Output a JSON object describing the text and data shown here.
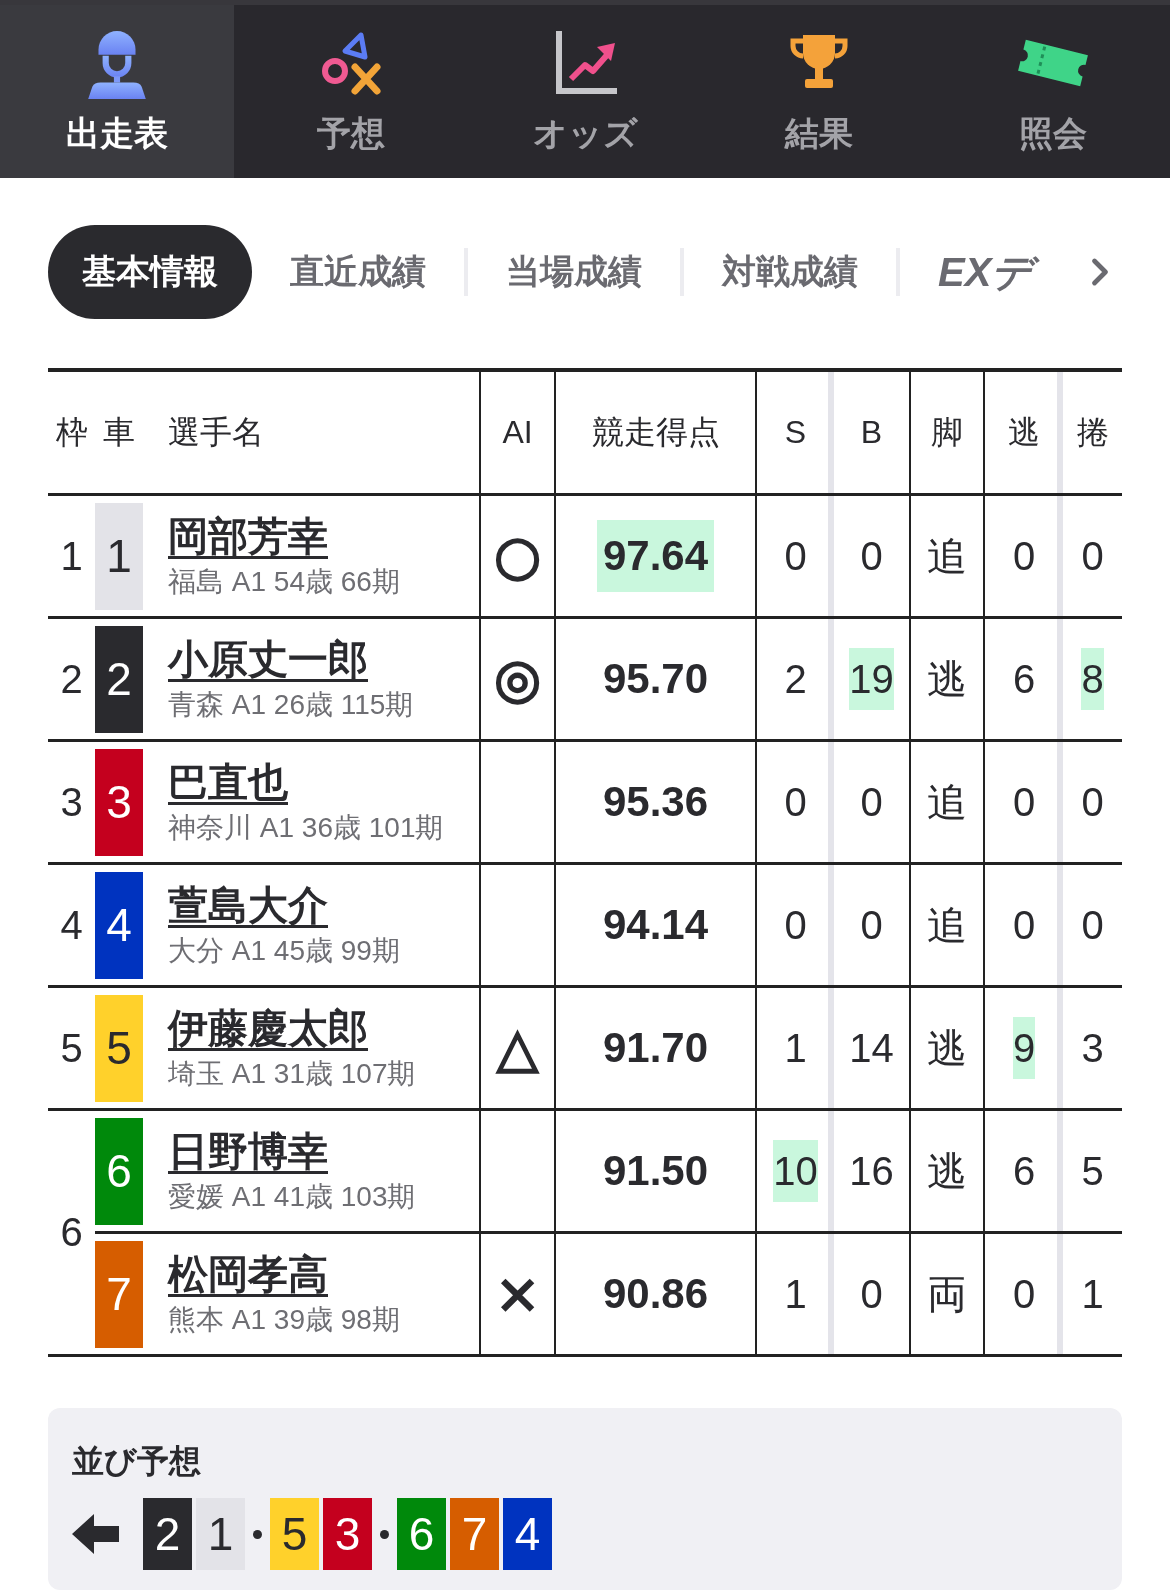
{
  "nav": {
    "tabs": [
      {
        "label": "出走表",
        "selected": true,
        "kind": "rider"
      },
      {
        "label": "予想",
        "selected": false,
        "kind": "shapes"
      },
      {
        "label": "オッズ",
        "selected": false,
        "kind": "chart"
      },
      {
        "label": "結果",
        "selected": false,
        "kind": "trophy"
      },
      {
        "label": "照会",
        "selected": false,
        "kind": "ticket"
      }
    ]
  },
  "subtabs": [
    {
      "label": "基本情報",
      "selected": true,
      "kind": "text"
    },
    {
      "label": "直近成績",
      "selected": false,
      "kind": "text"
    },
    {
      "label": "当場成績",
      "selected": false,
      "kind": "text"
    },
    {
      "label": "対戦成績",
      "selected": false,
      "kind": "text"
    },
    {
      "label": "EXデ",
      "selected": false,
      "kind": "logo"
    }
  ],
  "table": {
    "columns": [
      "枠",
      "車",
      "選手名",
      "AI",
      "競走得点",
      "S",
      "B",
      "脚",
      "逃",
      "捲"
    ],
    "frames": [
      {
        "frame": "1",
        "riders": [
          {
            "car": "1",
            "color": "#e3e3e8",
            "name": "岡部芳幸",
            "profile": "福島 A1 54歳 66期",
            "ai_mark": "○",
            "score": {
              "value": "97.64",
              "highlight": true
            },
            "stats": [
              {
                "value": "0",
                "highlight": false
              },
              {
                "value": "0",
                "highlight": false
              },
              {
                "value": "追",
                "highlight": false
              },
              {
                "value": "0",
                "highlight": false
              },
              {
                "value": "0",
                "highlight": false
              }
            ]
          }
        ]
      },
      {
        "frame": "2",
        "riders": [
          {
            "car": "2",
            "color": "#2a2a2e",
            "name": "小原丈一郎",
            "profile": "青森 A1 26歳 115期",
            "ai_mark": "◎",
            "score": {
              "value": "95.70",
              "highlight": false
            },
            "stats": [
              {
                "value": "2",
                "highlight": false
              },
              {
                "value": "19",
                "highlight": true
              },
              {
                "value": "逃",
                "highlight": false
              },
              {
                "value": "6",
                "highlight": false
              },
              {
                "value": "8",
                "highlight": true
              }
            ]
          }
        ]
      },
      {
        "frame": "3",
        "riders": [
          {
            "car": "3",
            "color": "#c4001e",
            "name": "巴直也",
            "profile": "神奈川 A1 36歳 101期",
            "score": {
              "value": "95.36",
              "highlight": false
            },
            "stats": [
              {
                "value": "0",
                "highlight": false
              },
              {
                "value": "0",
                "highlight": false
              },
              {
                "value": "追",
                "highlight": false
              },
              {
                "value": "0",
                "highlight": false
              },
              {
                "value": "0",
                "highlight": false
              }
            ]
          }
        ]
      },
      {
        "frame": "4",
        "riders": [
          {
            "car": "4",
            "color": "#0033bf",
            "name": "萱島大介",
            "profile": "大分 A1 45歳 99期",
            "score": {
              "value": "94.14",
              "highlight": false
            },
            "stats": [
              {
                "value": "0",
                "highlight": false
              },
              {
                "value": "0",
                "highlight": false
              },
              {
                "value": "追",
                "highlight": false
              },
              {
                "value": "0",
                "highlight": false
              },
              {
                "value": "0",
                "highlight": false
              }
            ]
          }
        ]
      },
      {
        "frame": "5",
        "riders": [
          {
            "car": "5",
            "color": "#ffd12b",
            "name": "伊藤慶太郎",
            "profile": "埼玉 A1 31歳 107期",
            "ai_mark": "△",
            "score": {
              "value": "91.70",
              "highlight": false
            },
            "stats": [
              {
                "value": "1",
                "highlight": false
              },
              {
                "value": "14",
                "highlight": false
              },
              {
                "value": "逃",
                "highlight": false
              },
              {
                "value": "9",
                "highlight": true
              },
              {
                "value": "3",
                "highlight": false
              }
            ]
          }
        ]
      },
      {
        "frame": "6",
        "riders": [
          {
            "car": "6",
            "color": "#00890b",
            "name": "日野博幸",
            "profile": "愛媛 A1 41歳 103期",
            "score": {
              "value": "91.50",
              "highlight": false
            },
            "stats": [
              {
                "value": "10",
                "highlight": true
              },
              {
                "value": "16",
                "highlight": false
              },
              {
                "value": "逃",
                "highlight": false
              },
              {
                "value": "6",
                "highlight": false
              },
              {
                "value": "5",
                "highlight": false
              }
            ]
          },
          {
            "car": "7",
            "color": "#d65d00",
            "name": "松岡孝高",
            "profile": "熊本 A1 39歳 98期",
            "ai_mark": "×",
            "score": {
              "value": "90.86",
              "highlight": false
            },
            "stats": [
              {
                "value": "1",
                "highlight": false
              },
              {
                "value": "0",
                "highlight": false
              },
              {
                "value": "両",
                "highlight": false
              },
              {
                "value": "0",
                "highlight": false
              },
              {
                "value": "1",
                "highlight": false
              }
            ]
          }
        ]
      }
    ]
  },
  "line_prediction": {
    "title": "並び予想",
    "groups": [
      {
        "cars": [
          {
            "car": "2",
            "color": "#2a2a2e"
          },
          {
            "car": "1",
            "color": "#e3e3e8"
          }
        ]
      },
      {
        "cars": [
          {
            "car": "5",
            "color": "#ffd12b"
          },
          {
            "car": "3",
            "color": "#c4001e"
          }
        ]
      },
      {
        "cars": [
          {
            "car": "6",
            "color": "#00890b"
          },
          {
            "car": "7",
            "color": "#d65d00"
          },
          {
            "car": "4",
            "color": "#0033bf"
          }
        ]
      }
    ]
  }
}
